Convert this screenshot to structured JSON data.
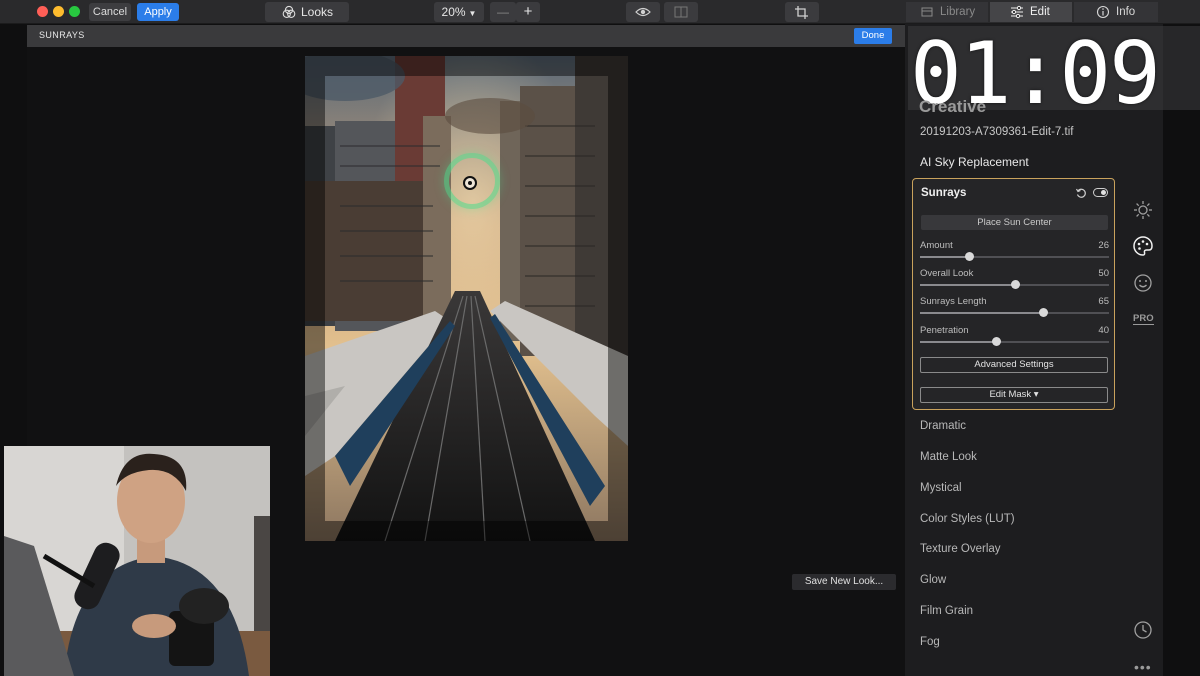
{
  "toolbar": {
    "cancel_label": "Cancel",
    "apply_label": "Apply",
    "looks_label": "Looks",
    "zoom_value": "20%",
    "minus_label": "—",
    "plus_label": "+",
    "tabs": [
      {
        "label": "Library",
        "icon": "library-icon",
        "active": false
      },
      {
        "label": "Edit",
        "icon": "sliders-icon",
        "active": true
      },
      {
        "label": "Info",
        "icon": "info-icon",
        "active": false
      }
    ]
  },
  "subheader": {
    "title": "SUNRAYS",
    "done_label": "Done"
  },
  "canvas": {
    "save_look_label": "Save New Look..."
  },
  "overlay": {
    "timer": "01:09"
  },
  "panel": {
    "section_heading": "Creative",
    "filename": "20191203-A7309361-Edit-7.tif",
    "ai_sky_label": "AI Sky Replacement",
    "sunrays": {
      "title": "Sunrays",
      "place_sun_label": "Place Sun Center",
      "sliders": [
        {
          "label": "Amount",
          "value": "26",
          "position": 0.26
        },
        {
          "label": "Overall Look",
          "value": "50",
          "position": 0.5
        },
        {
          "label": "Sunrays Length",
          "value": "65",
          "position": 0.65
        },
        {
          "label": "Penetration",
          "value": "40",
          "position": 0.4
        }
      ],
      "advanced_label": "Advanced Settings",
      "edit_mask_label": "Edit Mask ▾"
    },
    "looks": [
      "Dramatic",
      "Matte Look",
      "Mystical",
      "Color Styles (LUT)",
      "Texture Overlay",
      "Glow",
      "Film Grain",
      "Fog"
    ]
  },
  "sidebar_icons": {
    "pro_label": "PRO"
  },
  "colors": {
    "accent_blue": "#2b7de9",
    "card_border": "#c9a25c",
    "sun_ring": "#4cdc8c"
  }
}
